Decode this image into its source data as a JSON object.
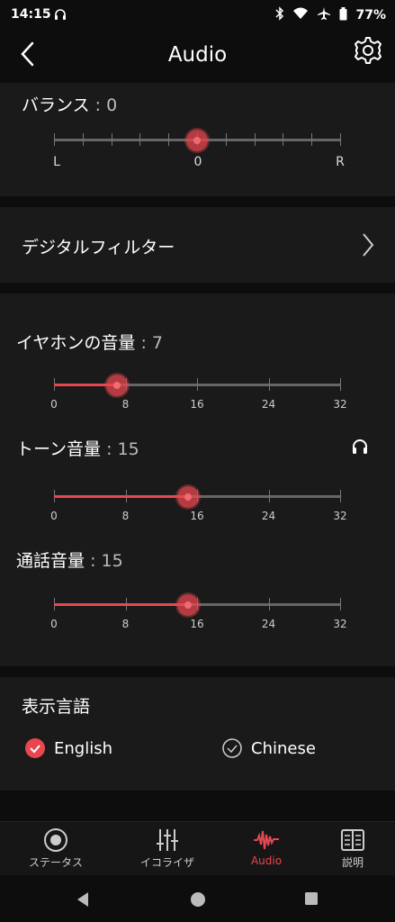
{
  "status": {
    "time": "14:15",
    "battery": "77%"
  },
  "header": {
    "title": "Audio"
  },
  "balance": {
    "label": "バランス",
    "value": ": 0",
    "left": "L",
    "center": "0",
    "right": "R"
  },
  "filter": {
    "label": "デジタルフィルター"
  },
  "volume_ticks": [
    "0",
    "8",
    "16",
    "24",
    "32"
  ],
  "earphone_volume": {
    "label": "イヤホンの音量",
    "value": ": 7",
    "level": 7,
    "max": 32
  },
  "tone_volume": {
    "label": "トーン音量",
    "value": ": 15",
    "level": 15,
    "max": 32
  },
  "call_volume": {
    "label": "通話音量",
    "value": ": 15",
    "level": 15,
    "max": 32
  },
  "language": {
    "title": "表示言語",
    "options": [
      {
        "label": "English",
        "selected": true
      },
      {
        "label": "Chinese",
        "selected": false
      }
    ]
  },
  "nav": {
    "items": [
      {
        "label": "ステータス",
        "icon": "status-icon"
      },
      {
        "label": "イコライザ",
        "icon": "equalizer-icon"
      },
      {
        "label": "Audio",
        "icon": "audio-wave-icon",
        "active": true
      },
      {
        "label": "説明",
        "icon": "manual-icon"
      }
    ]
  },
  "accent": "#e8474f"
}
